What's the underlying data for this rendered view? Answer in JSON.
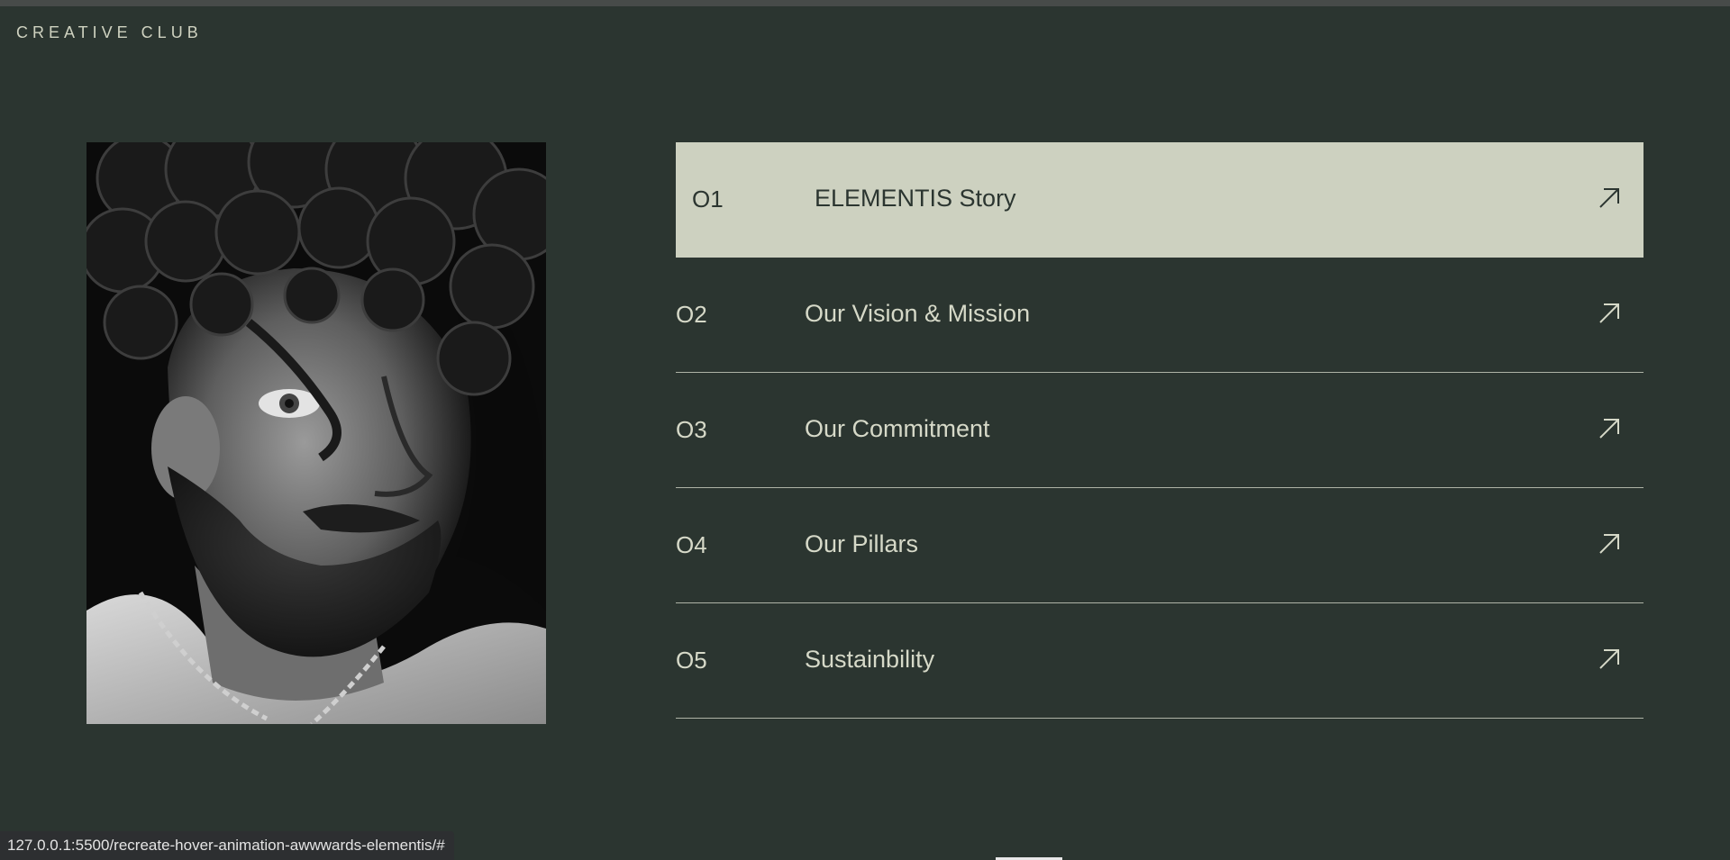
{
  "header": {
    "brand": "CREATIVE CLUB"
  },
  "portrait": {
    "alt": "Black and white portrait of a curly-haired bearded man"
  },
  "menu": {
    "items": [
      {
        "number": "O1",
        "label": "ELEMENTIS Story",
        "active": true,
        "icon": "arrow-up-right-icon"
      },
      {
        "number": "O2",
        "label": "Our Vision & Mission",
        "active": false,
        "icon": "arrow-up-right-icon"
      },
      {
        "number": "O3",
        "label": "Our Commitment",
        "active": false,
        "icon": "arrow-up-right-icon"
      },
      {
        "number": "O4",
        "label": "Our Pillars",
        "active": false,
        "icon": "arrow-up-right-icon"
      },
      {
        "number": "O5",
        "label": "Sustainbility",
        "active": false,
        "icon": "arrow-up-right-icon"
      }
    ]
  },
  "status_bar": {
    "url": "127.0.0.1:5500/recreate-hover-animation-awwwards-elementis/#"
  },
  "colors": {
    "background": "#2b3530",
    "accent": "#cdd1c0",
    "text": "#d6d9c8"
  }
}
